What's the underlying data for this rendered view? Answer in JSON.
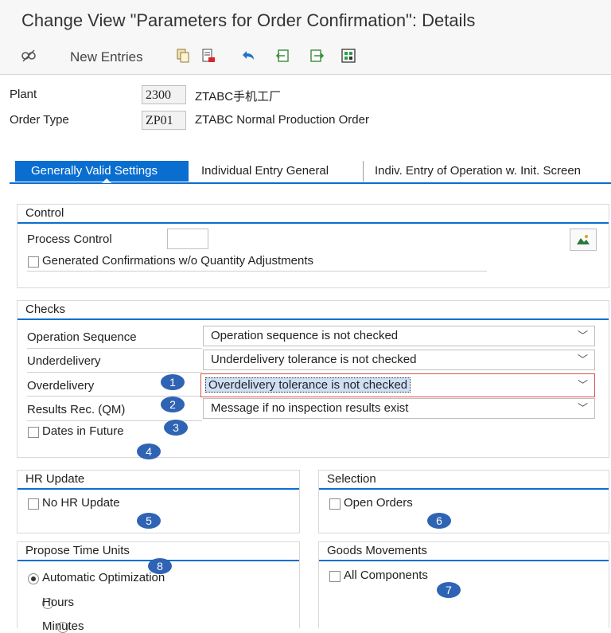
{
  "window": {
    "title": "Change View \"Parameters for Order Confirmation\": Details"
  },
  "toolbar": {
    "new_entries_label": "New Entries",
    "icons": [
      "display-change-icon",
      "copy-icon",
      "delete-icon",
      "undo-icon",
      "previous-entry-icon",
      "next-entry-icon",
      "transport-icon"
    ]
  },
  "header": {
    "plant": {
      "label": "Plant",
      "value": "2300",
      "desc": "ZTABC手机工厂"
    },
    "order_type": {
      "label": "Order Type",
      "value": "ZP01",
      "desc": "ZTABC Normal Production Order"
    }
  },
  "tabs": [
    {
      "label": "Generally Valid Settings"
    },
    {
      "label": "Individual Entry General"
    },
    {
      "label": "Indiv. Entry of Operation w. Init. Screen"
    }
  ],
  "control": {
    "title": "Control",
    "process_control_label": "Process Control",
    "process_control_value": "",
    "generated_conf_label": "Generated Confirmations w/o Quantity Adjustments"
  },
  "checks": {
    "title": "Checks",
    "operation_sequence": {
      "label": "Operation Sequence",
      "value": "Operation sequence is not checked"
    },
    "underdelivery": {
      "label": "Underdelivery",
      "value": "Underdelivery tolerance is not checked"
    },
    "overdelivery": {
      "label": "Overdelivery",
      "value": "Overdelivery tolerance is not checked"
    },
    "results_rec": {
      "label": "Results Rec. (QM)",
      "value": "Message if no inspection results exist"
    },
    "dates_in_future_label": "Dates in Future"
  },
  "hr_update": {
    "title": "HR Update",
    "no_hr_update_label": "No HR Update"
  },
  "selection": {
    "title": "Selection",
    "open_orders_label": "Open Orders"
  },
  "propose_time_units": {
    "title": "Propose Time Units",
    "options": [
      "Automatic Optimization",
      "Hours",
      "Minutes"
    ],
    "selected": "Automatic Optimization"
  },
  "goods_movements": {
    "title": "Goods Movements",
    "all_components_label": "All Components"
  },
  "badges": [
    "1",
    "2",
    "3",
    "4",
    "5",
    "6",
    "7",
    "8"
  ],
  "colors": {
    "accent": "#0a6ed1",
    "badge": "#2f63b4",
    "highlight_border": "#d9534f"
  }
}
